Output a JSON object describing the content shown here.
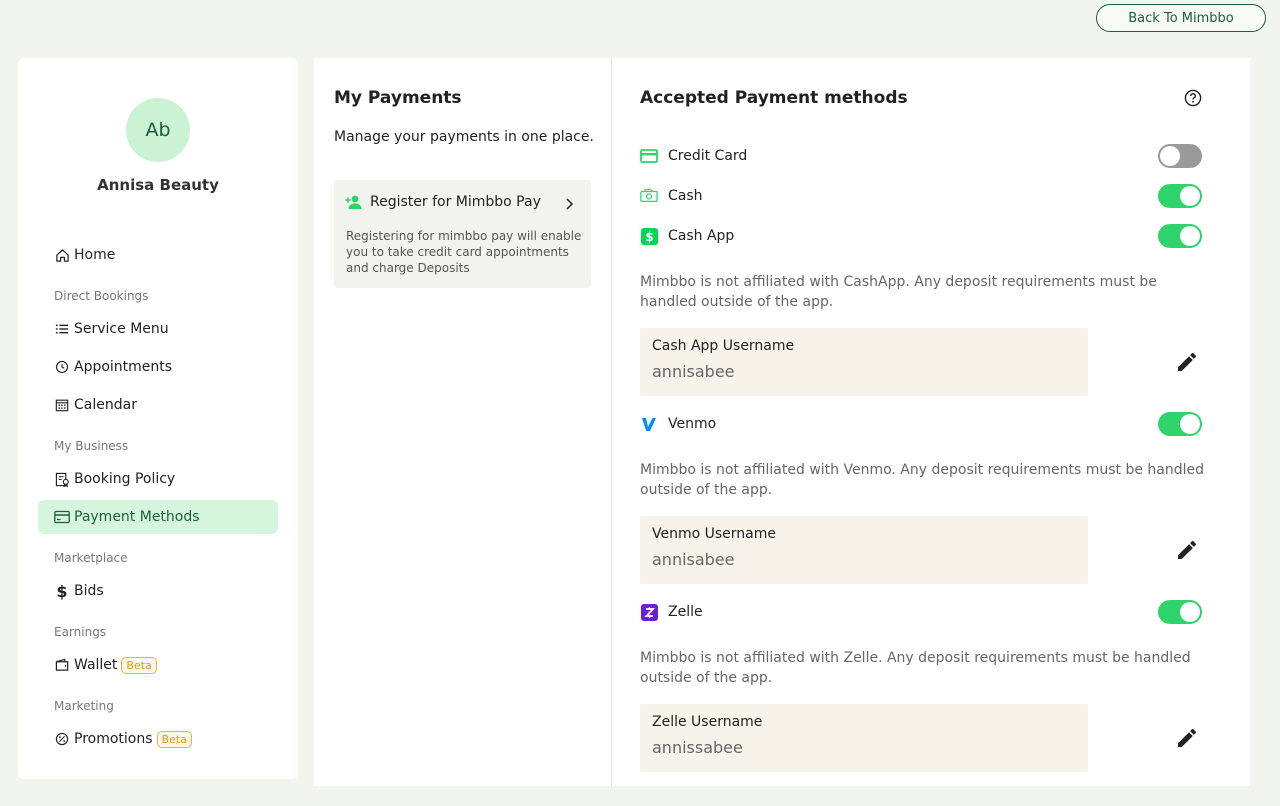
{
  "header": {
    "back_label": "Back To Mimbbo"
  },
  "profile": {
    "initials": "Ab",
    "name": "Annisa Beauty"
  },
  "sidebar": {
    "home": "Home",
    "section_direct": "Direct Bookings",
    "service_menu": "Service Menu",
    "appointments": "Appointments",
    "calendar": "Calendar",
    "section_business": "My Business",
    "booking_policy": "Booking Policy",
    "payment_methods": "Payment Methods",
    "section_marketplace": "Marketplace",
    "bids": "Bids",
    "section_earnings": "Earnings",
    "wallet": "Wallet",
    "wallet_badge": "Beta",
    "section_marketing": "Marketing",
    "promotions": "Promotions",
    "promotions_badge": "Beta"
  },
  "payments": {
    "title": "My Payments",
    "subtitle": "Manage your payments in one place.",
    "register_title": "Register for Mimbbo Pay",
    "register_desc": "Registering for mimbbo pay will enable you to take credit card appointments and charge Deposits"
  },
  "methods": {
    "title": "Accepted Payment methods",
    "credit_card": {
      "label": "Credit Card",
      "enabled": false
    },
    "cash": {
      "label": "Cash",
      "enabled": true
    },
    "cash_app": {
      "label": "Cash App",
      "enabled": true,
      "note": "Mimbbo is not affiliated with CashApp. Any deposit requirements must be handled outside of the app.",
      "field_label": "Cash App Username",
      "field_value": "annisabee"
    },
    "venmo": {
      "label": "Venmo",
      "enabled": true,
      "note": "Mimbbo is not affiliated with Venmo. Any deposit requirements must be handled outside of the app.",
      "field_label": "Venmo Username",
      "field_value": "annisabee"
    },
    "zelle": {
      "label": "Zelle",
      "enabled": true,
      "note": "Mimbbo is not affiliated with Zelle. Any deposit requirements must be handled outside of the app.",
      "field_label": "Zelle Username",
      "field_value": "annissabee"
    }
  },
  "colors": {
    "accent": "#2ed36a",
    "brand_dark": "#1f5e3c",
    "active_bg": "#d5f6dc"
  }
}
